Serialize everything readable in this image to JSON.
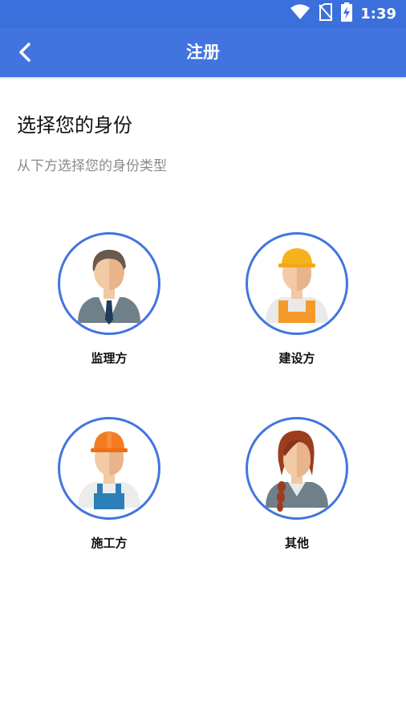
{
  "status_bar": {
    "time": "1:39",
    "icons": [
      "wifi-icon",
      "no-sim-icon",
      "battery-charging-icon"
    ]
  },
  "app_bar": {
    "title": "注册",
    "back_icon": "chevron-left-icon"
  },
  "content": {
    "heading": "选择您的身份",
    "subheading": "从下方选择您的身份类型"
  },
  "roles": [
    {
      "label": "监理方",
      "avatar": "supervisor-avatar"
    },
    {
      "label": "建设方",
      "avatar": "owner-worker-avatar"
    },
    {
      "label": "施工方",
      "avatar": "construction-worker-avatar"
    },
    {
      "label": "其他",
      "avatar": "other-woman-avatar"
    }
  ],
  "colors": {
    "primary": "#4274e0",
    "status_bar": "#3b6fdc",
    "helmet_yellow": "#f6b21b",
    "helmet_orange": "#f47c20",
    "vest_orange": "#f39a2a",
    "overall_blue": "#2c7fb6"
  }
}
